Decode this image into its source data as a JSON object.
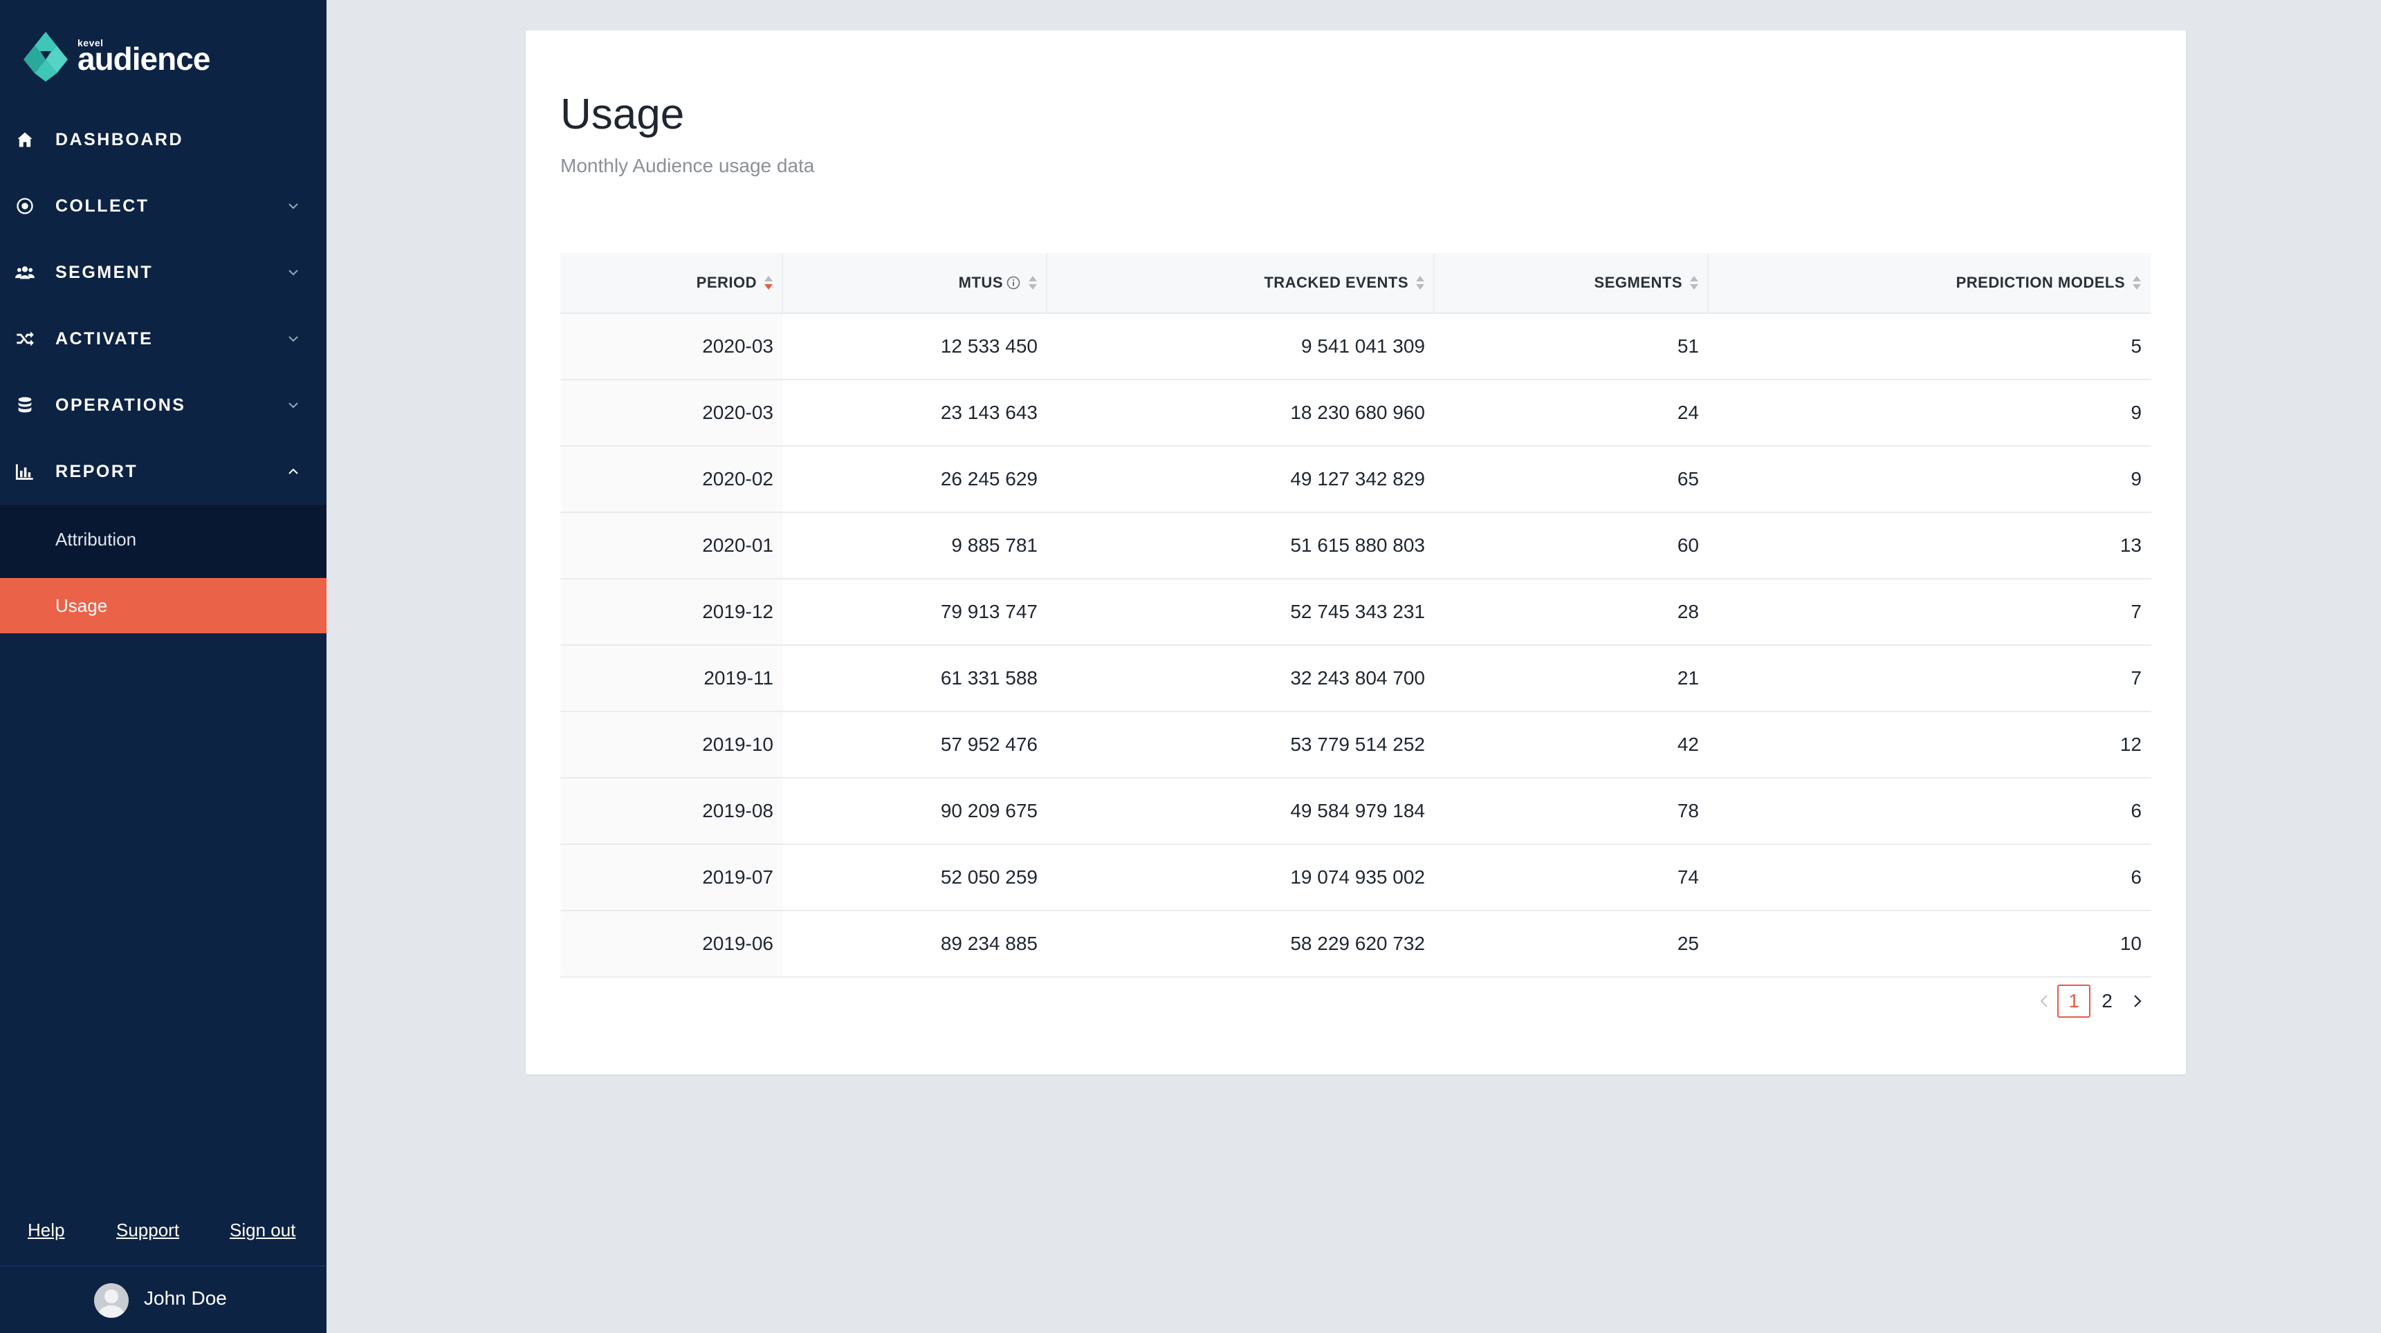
{
  "brand": {
    "small_label": "kevel",
    "name": "audience",
    "colors": {
      "primary_bg": "#0d2344",
      "accent": "#ea6349",
      "logo_teal": "#3ec6b7"
    }
  },
  "sidebar": {
    "items": [
      {
        "label": "DASHBOARD",
        "icon": "home-icon",
        "has_chevron": false
      },
      {
        "label": "COLLECT",
        "icon": "target-icon",
        "has_chevron": true,
        "expanded": false
      },
      {
        "label": "SEGMENT",
        "icon": "users-icon",
        "has_chevron": true,
        "expanded": false
      },
      {
        "label": "ACTIVATE",
        "icon": "shuffle-icon",
        "has_chevron": true,
        "expanded": false
      },
      {
        "label": "OPERATIONS",
        "icon": "database-icon",
        "has_chevron": true,
        "expanded": false
      },
      {
        "label": "REPORT",
        "icon": "bar-chart-icon",
        "has_chevron": true,
        "expanded": true
      }
    ],
    "report_submenu": [
      {
        "label": "Attribution",
        "active": false
      },
      {
        "label": "Usage",
        "active": true
      }
    ],
    "footer_links": {
      "help": "Help",
      "support": "Support",
      "sign_out": "Sign out"
    },
    "user": {
      "name": "John Doe"
    }
  },
  "main": {
    "title": "Usage",
    "subtitle": "Monthly Audience usage data",
    "table": {
      "columns": [
        {
          "key": "period",
          "label": "PERIOD",
          "sorted": "desc"
        },
        {
          "key": "mtus",
          "label": "MTUS",
          "info": true
        },
        {
          "key": "tracked_events",
          "label": "TRACKED EVENTS"
        },
        {
          "key": "segments",
          "label": "SEGMENTS"
        },
        {
          "key": "prediction_models",
          "label": "PREDICTION MODELS"
        }
      ],
      "rows": [
        {
          "period": "2020-03",
          "mtus": "12 533 450",
          "tracked_events": "9 541 041 309",
          "segments": "51",
          "prediction_models": "5"
        },
        {
          "period": "2020-03",
          "mtus": "23 143 643",
          "tracked_events": "18 230 680 960",
          "segments": "24",
          "prediction_models": "9"
        },
        {
          "period": "2020-02",
          "mtus": "26 245 629",
          "tracked_events": "49 127 342 829",
          "segments": "65",
          "prediction_models": "9"
        },
        {
          "period": "2020-01",
          "mtus": "9 885 781",
          "tracked_events": "51 615 880 803",
          "segments": "60",
          "prediction_models": "13"
        },
        {
          "period": "2019-12",
          "mtus": "79 913 747",
          "tracked_events": "52 745 343 231",
          "segments": "28",
          "prediction_models": "7"
        },
        {
          "period": "2019-11",
          "mtus": "61 331 588",
          "tracked_events": "32 243 804 700",
          "segments": "21",
          "prediction_models": "7"
        },
        {
          "period": "2019-10",
          "mtus": "57 952 476",
          "tracked_events": "53 779 514 252",
          "segments": "42",
          "prediction_models": "12"
        },
        {
          "period": "2019-08",
          "mtus": "90 209 675",
          "tracked_events": "49 584 979 184",
          "segments": "78",
          "prediction_models": "6"
        },
        {
          "period": "2019-07",
          "mtus": "52 050 259",
          "tracked_events": "19 074 935 002",
          "segments": "74",
          "prediction_models": "6"
        },
        {
          "period": "2019-06",
          "mtus": "89 234 885",
          "tracked_events": "58 229 620 732",
          "segments": "25",
          "prediction_models": "10"
        }
      ]
    },
    "pagination": {
      "pages": [
        "1",
        "2"
      ],
      "current": "1"
    }
  }
}
